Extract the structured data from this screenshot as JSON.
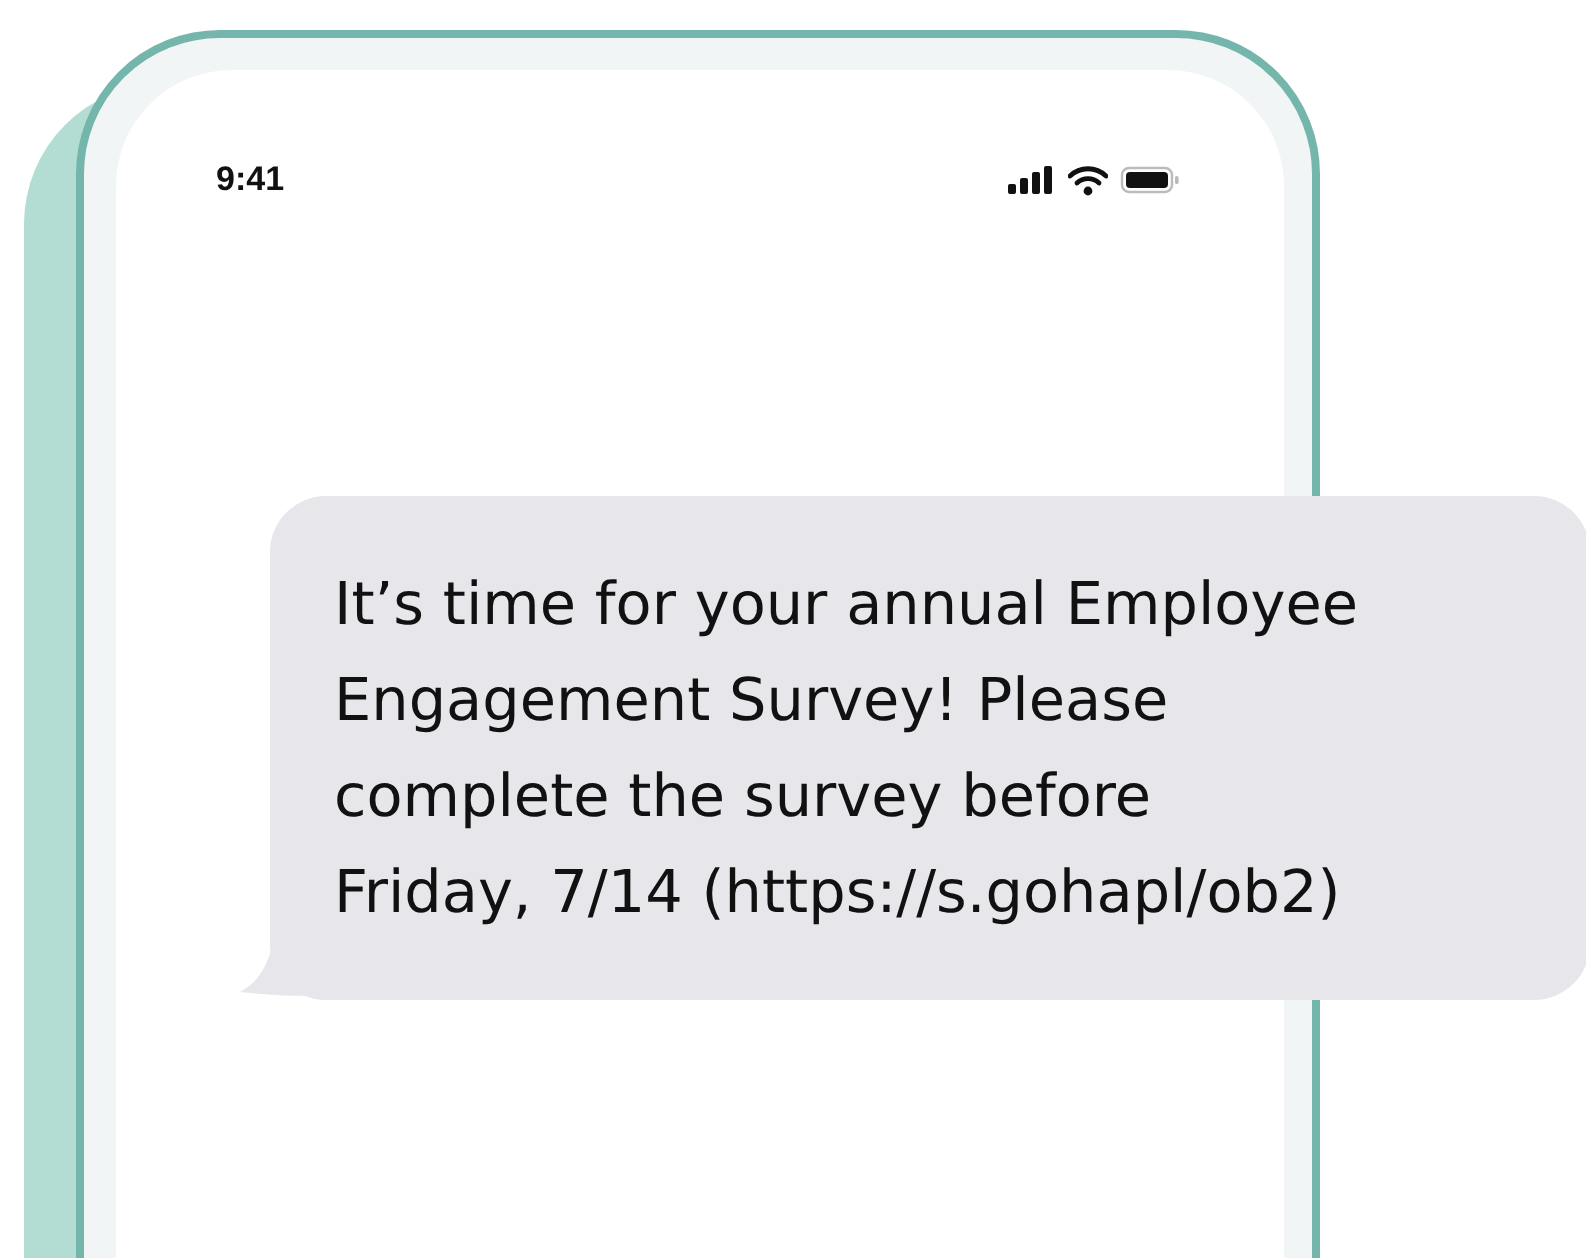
{
  "status_bar": {
    "time": "9:41"
  },
  "message": {
    "text": "It’s time for your annual Employee\nEngagement Survey! Please\ncomplete the survey before\nFriday, 7/14 (https://s.gohapl/ob2)"
  }
}
